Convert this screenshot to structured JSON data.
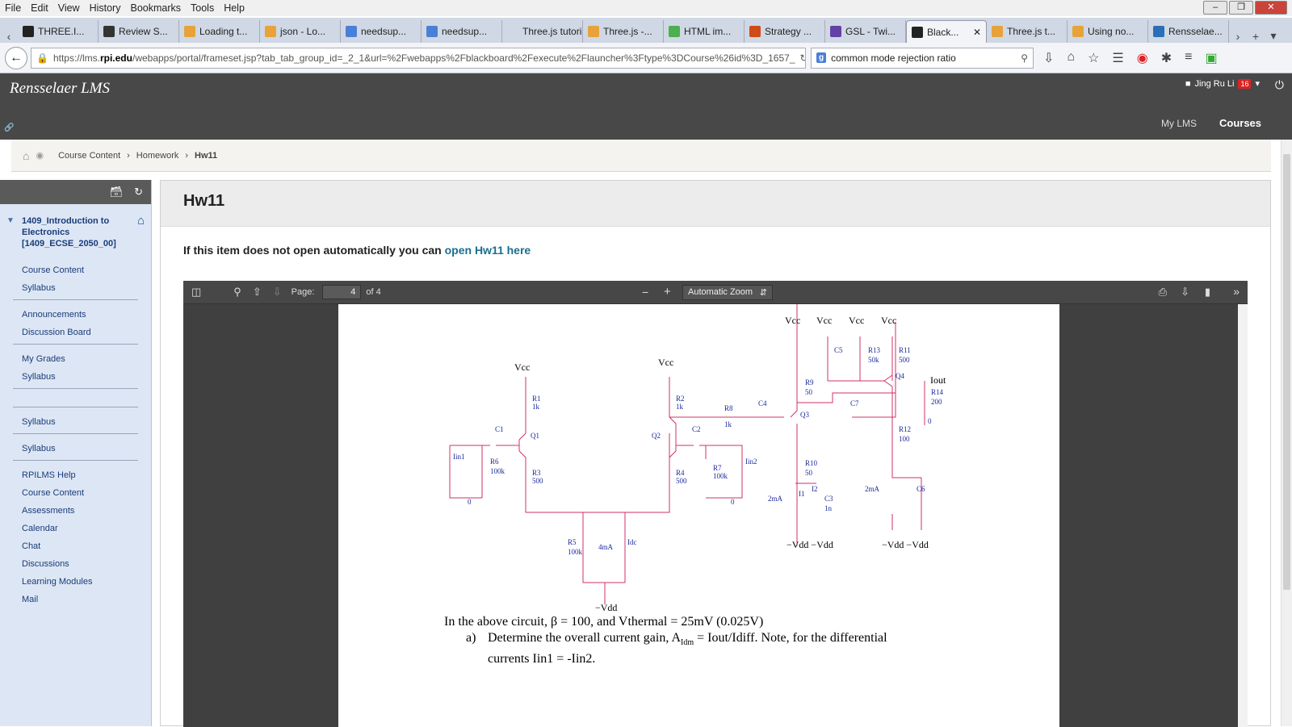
{
  "menu": [
    "File",
    "Edit",
    "View",
    "History",
    "Bookmarks",
    "Tools",
    "Help"
  ],
  "tabs": [
    {
      "label": "THREE.I...",
      "color": "#222"
    },
    {
      "label": "Review S...",
      "color": "#333"
    },
    {
      "label": "Loading t...",
      "color": "#e8a23a"
    },
    {
      "label": "json - Lo...",
      "color": "#e8a23a"
    },
    {
      "label": "needsup...",
      "color": "#4a7fd8"
    },
    {
      "label": "needsup...",
      "color": "#4a7fd8"
    },
    {
      "label": "Three.js tutori...",
      "color": "#cfd8e4"
    },
    {
      "label": "Three.js -...",
      "color": "#e8a23a"
    },
    {
      "label": "HTML im...",
      "color": "#4caf50"
    },
    {
      "label": "Strategy ...",
      "color": "#d04a1a"
    },
    {
      "label": "GSL - Twi...",
      "color": "#6441a5"
    },
    {
      "label": "Black...",
      "color": "#222",
      "active": true
    },
    {
      "label": "Three.js t...",
      "color": "#e8a23a"
    },
    {
      "label": "Using no...",
      "color": "#e8a23a"
    },
    {
      "label": "Rensselae...",
      "color": "#2a6fb8"
    }
  ],
  "url": {
    "pre": "https://lms.",
    "domain": "rpi.edu",
    "rest": "/webapps/portal/frameset.jsp?tab_tab_group_id=_2_1&url=%2Fwebapps%2Fblackboard%2Fexecute%2Flauncher%3Ftype%3DCourse%26id%3D_1657_"
  },
  "search": "common mode rejection ratio",
  "lms": {
    "title": "Rensselaer LMS",
    "user": "Jing Ru Li",
    "notif": "16",
    "mylms": "My LMS",
    "courses": "Courses"
  },
  "breadcrumb": [
    "Course Content",
    "Homework",
    "Hw11"
  ],
  "course": {
    "title": "1409_Introduction to Electronics [1409_ECSE_2050_00]"
  },
  "side_groups": [
    [
      "Course Content",
      "Syllabus"
    ],
    [
      "Announcements",
      "Discussion Board"
    ],
    [
      "My Grades",
      "Syllabus"
    ],
    [],
    [
      "Syllabus"
    ],
    [
      "Syllabus"
    ],
    [
      "RPILMS Help",
      "Course Content",
      "Assessments",
      "Calendar",
      "Chat",
      "Discussions",
      "Learning Modules",
      "Mail"
    ]
  ],
  "page": {
    "title": "Hw11",
    "open_text": "If this item does not open automatically you can ",
    "open_link": "open Hw11 here"
  },
  "pdf": {
    "page_label": "Page:",
    "page": "4",
    "of": "of 4",
    "zoom": "Automatic Zoom"
  },
  "circuit": {
    "vcc": "Vcc",
    "vdd": "−Vdd",
    "vdd_pair": "−Vdd −Vdd",
    "iout": "Iout",
    "labels": [
      "R1",
      "1k",
      "R2",
      "1k",
      "R3",
      "500",
      "R4",
      "500",
      "R5",
      "100k",
      "R6",
      "100k",
      "R7",
      "100k",
      "R8",
      "1k",
      "R9",
      "50",
      "R10",
      "50",
      "R11",
      "500",
      "R12",
      "100",
      "R13",
      "50k",
      "R14",
      "200",
      "C1",
      "C2",
      "C3",
      "1n",
      "C4",
      "C5",
      "C6",
      "C7",
      "Q1",
      "Q2",
      "Q3",
      "Q4",
      "Iin1",
      "Iin2",
      "4mA",
      "Idc",
      "2mA",
      "I1",
      "2mA",
      "I2",
      "0",
      "0",
      "0"
    ]
  },
  "problem": {
    "line1": "In the above circuit, β = 100, and Vthermal = 25mV (0.025V)",
    "item_a_label": "a)",
    "item_a": "Determine the overall current gain, A",
    "item_a_sub": "Idm",
    "item_a_rest": " = Iout/Idiff. Note, for the differential",
    "item_a_line2": "currents Iin1 = -Iin2."
  }
}
